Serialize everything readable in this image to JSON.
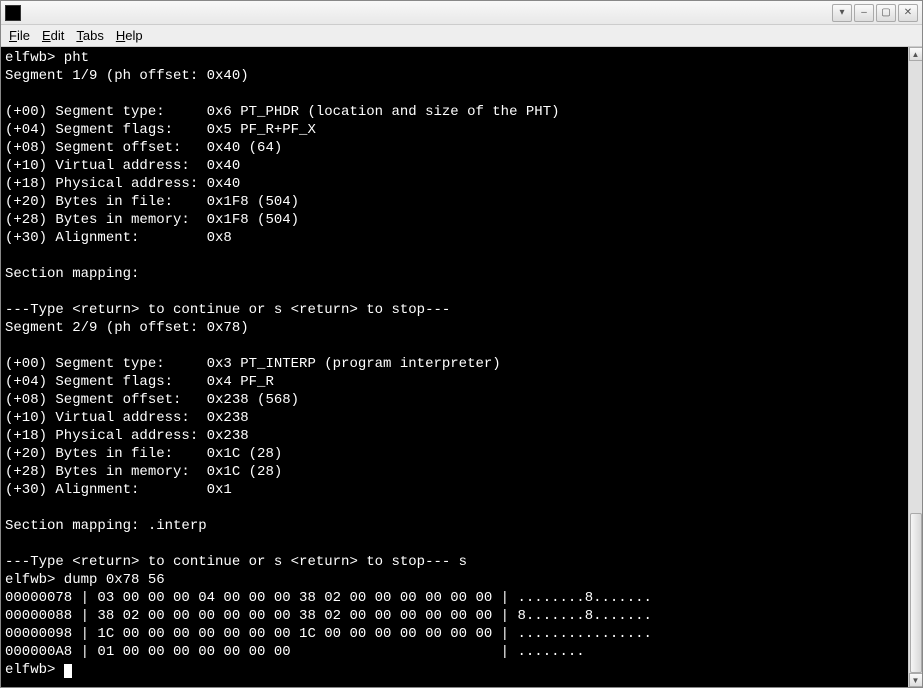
{
  "menubar": {
    "file": "File",
    "edit": "Edit",
    "tabs": "Tabs",
    "help": "Help"
  },
  "terminal": {
    "prompt1": "elfwb> pht",
    "seg1_header": "Segment 1/9 (ph offset: 0x40)",
    "seg1_type": "(+00) Segment type:     0x6 PT_PHDR (location and size of the PHT)",
    "seg1_flags": "(+04) Segment flags:    0x5 PF_R+PF_X",
    "seg1_offset": "(+08) Segment offset:   0x40 (64)",
    "seg1_vaddr": "(+10) Virtual address:  0x40",
    "seg1_paddr": "(+18) Physical address: 0x40",
    "seg1_filesz": "(+20) Bytes in file:    0x1F8 (504)",
    "seg1_memsz": "(+28) Bytes in memory:  0x1F8 (504)",
    "seg1_align": "(+30) Alignment:        0x8",
    "seg1_mapping": "Section mapping:",
    "continue1": "---Type <return> to continue or s <return> to stop---",
    "seg2_header": "Segment 2/9 (ph offset: 0x78)",
    "seg2_type": "(+00) Segment type:     0x3 PT_INTERP (program interpreter)",
    "seg2_flags": "(+04) Segment flags:    0x4 PF_R",
    "seg2_offset": "(+08) Segment offset:   0x238 (568)",
    "seg2_vaddr": "(+10) Virtual address:  0x238",
    "seg2_paddr": "(+18) Physical address: 0x238",
    "seg2_filesz": "(+20) Bytes in file:    0x1C (28)",
    "seg2_memsz": "(+28) Bytes in memory:  0x1C (28)",
    "seg2_align": "(+30) Alignment:        0x1",
    "seg2_mapping": "Section mapping: .interp",
    "continue2": "---Type <return> to continue or s <return> to stop--- s",
    "prompt2": "elfwb> dump 0x78 56",
    "dump1": "00000078 | 03 00 00 00 04 00 00 00 38 02 00 00 00 00 00 00 | ........8.......",
    "dump2": "00000088 | 38 02 00 00 00 00 00 00 38 02 00 00 00 00 00 00 | 8.......8.......",
    "dump3": "00000098 | 1C 00 00 00 00 00 00 00 1C 00 00 00 00 00 00 00 | ................",
    "dump4": "000000A8 | 01 00 00 00 00 00 00 00                         | ........",
    "prompt3": "elfwb> "
  }
}
